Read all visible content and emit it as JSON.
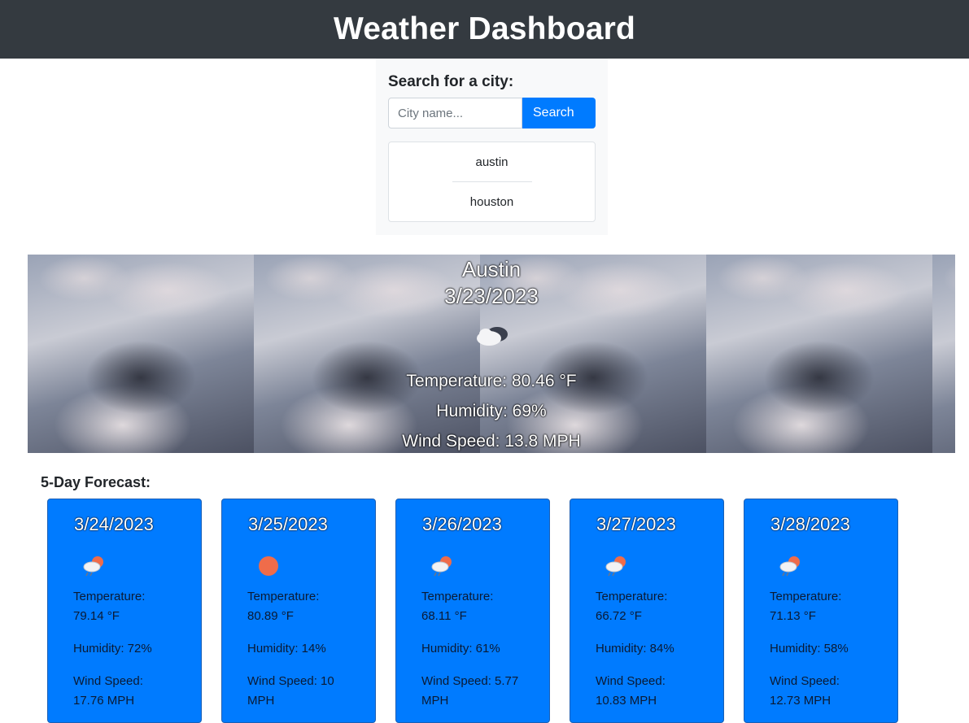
{
  "header": {
    "title": "Weather Dashboard"
  },
  "search": {
    "label": "Search for a city:",
    "placeholder": "City name...",
    "button_label": "Search",
    "history": [
      "austin",
      "houston"
    ]
  },
  "current": {
    "city": "Austin",
    "date": "3/23/2023",
    "icon": "cloudy-icon",
    "temperature": "Temperature: 80.46 °F",
    "humidity": "Humidity: 69%",
    "wind": "Wind Speed: 13.8 MPH"
  },
  "forecast": {
    "title": "5-Day Forecast:",
    "days": [
      {
        "date": "3/24/2023",
        "icon": "rain-sun-icon",
        "temp_label": "Temperature:",
        "temp_value": "79.14 °F",
        "humidity": "Humidity: 72%",
        "wind_label": "Wind Speed:",
        "wind_value": "17.76 MPH"
      },
      {
        "date": "3/25/2023",
        "icon": "sun-icon",
        "temp_label": "Temperature:",
        "temp_value": "80.89 °F",
        "humidity": "Humidity: 14%",
        "wind_label": "Wind Speed: 10",
        "wind_value": "MPH"
      },
      {
        "date": "3/26/2023",
        "icon": "rain-sun-icon",
        "temp_label": "Temperature:",
        "temp_value": "68.11 °F",
        "humidity": "Humidity: 61%",
        "wind_label": "Wind Speed: 5.77",
        "wind_value": "MPH"
      },
      {
        "date": "3/27/2023",
        "icon": "rain-sun-icon",
        "temp_label": "Temperature:",
        "temp_value": "66.72 °F",
        "humidity": "Humidity: 84%",
        "wind_label": "Wind Speed:",
        "wind_value": "10.83 MPH"
      },
      {
        "date": "3/28/2023",
        "icon": "rain-sun-icon",
        "temp_label": "Temperature:",
        "temp_value": "71.13 °F",
        "humidity": "Humidity: 58%",
        "wind_label": "Wind Speed:",
        "wind_value": "12.73 MPH"
      }
    ]
  },
  "colors": {
    "header_bg": "#343a40",
    "accent": "#007bff",
    "panel_bg": "#f8f9fa",
    "sun": "#ef6c4a"
  }
}
